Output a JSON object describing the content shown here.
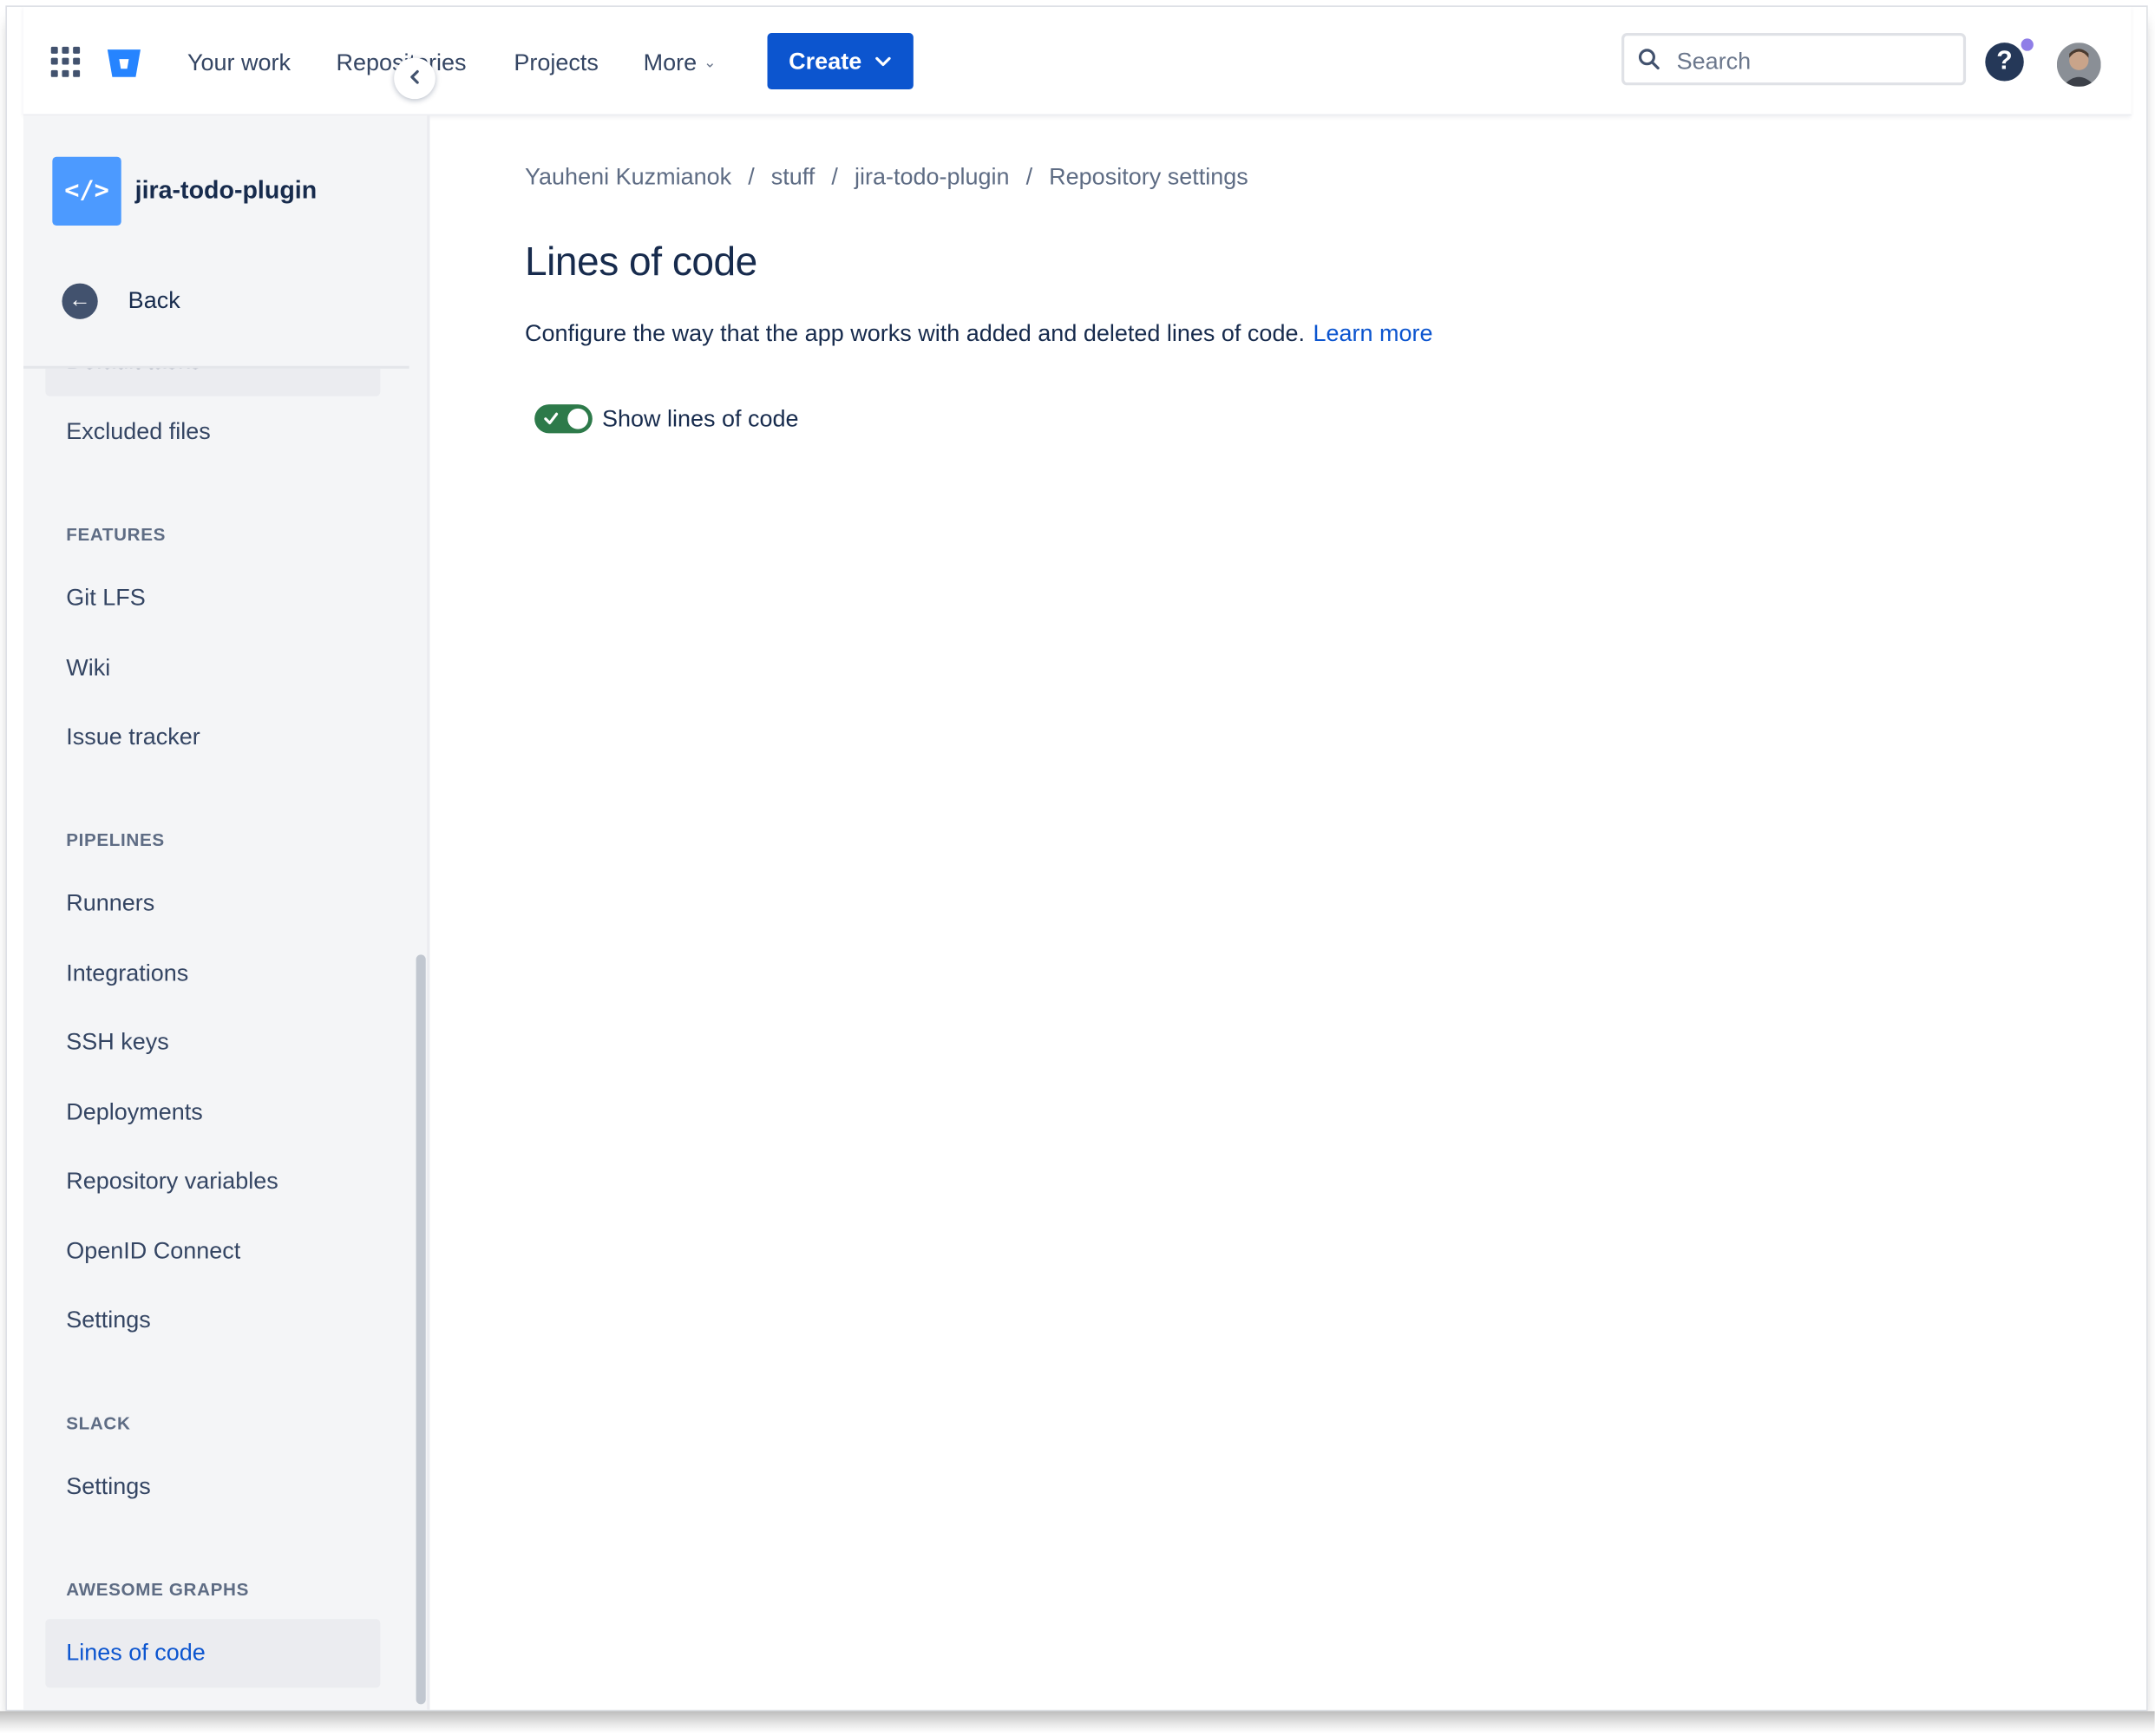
{
  "topnav": {
    "links": [
      "Your work",
      "Repositories",
      "Projects"
    ],
    "more_label": "More",
    "create_label": "Create",
    "search_placeholder": "Search",
    "help_glyph": "?"
  },
  "sidebar": {
    "repo_name": "jira-todo-plugin",
    "repo_glyph": "</>",
    "back_label": "Back",
    "partial_item": "Default tasks",
    "excluded_files": "Excluded files",
    "sections": {
      "features": {
        "heading": "FEATURES",
        "items": [
          "Git LFS",
          "Wiki",
          "Issue tracker"
        ]
      },
      "pipelines": {
        "heading": "PIPELINES",
        "items": [
          "Runners",
          "Integrations",
          "SSH keys",
          "Deployments",
          "Repository variables",
          "OpenID Connect",
          "Settings"
        ]
      },
      "slack": {
        "heading": "SLACK",
        "items": [
          "Settings"
        ]
      },
      "awesome_graphs": {
        "heading": "AWESOME GRAPHS",
        "items": [
          "Lines of code"
        ]
      }
    }
  },
  "main": {
    "breadcrumb": [
      "Yauheni Kuzmianok",
      "stuff",
      "jira-todo-plugin",
      "Repository settings"
    ],
    "breadcrumb_sep": "/",
    "title": "Lines of code",
    "description": "Configure the way that the app works with added and deleted lines of code.",
    "learn_more": "Learn more",
    "toggle_label": "Show lines of code",
    "toggle_on": true
  },
  "colors": {
    "brand_blue": "#0c55cf",
    "repo_icon": "#4c9aff",
    "toggle_green": "#2d7a4a",
    "sidebar_bg": "#f4f5f7"
  },
  "icons": [
    "app-switcher-icon",
    "bitbucket-logo-icon",
    "chevron-down-icon",
    "search-icon",
    "help-icon",
    "avatar",
    "code-icon",
    "chevron-left-icon",
    "back-arrow-icon",
    "check-icon"
  ]
}
